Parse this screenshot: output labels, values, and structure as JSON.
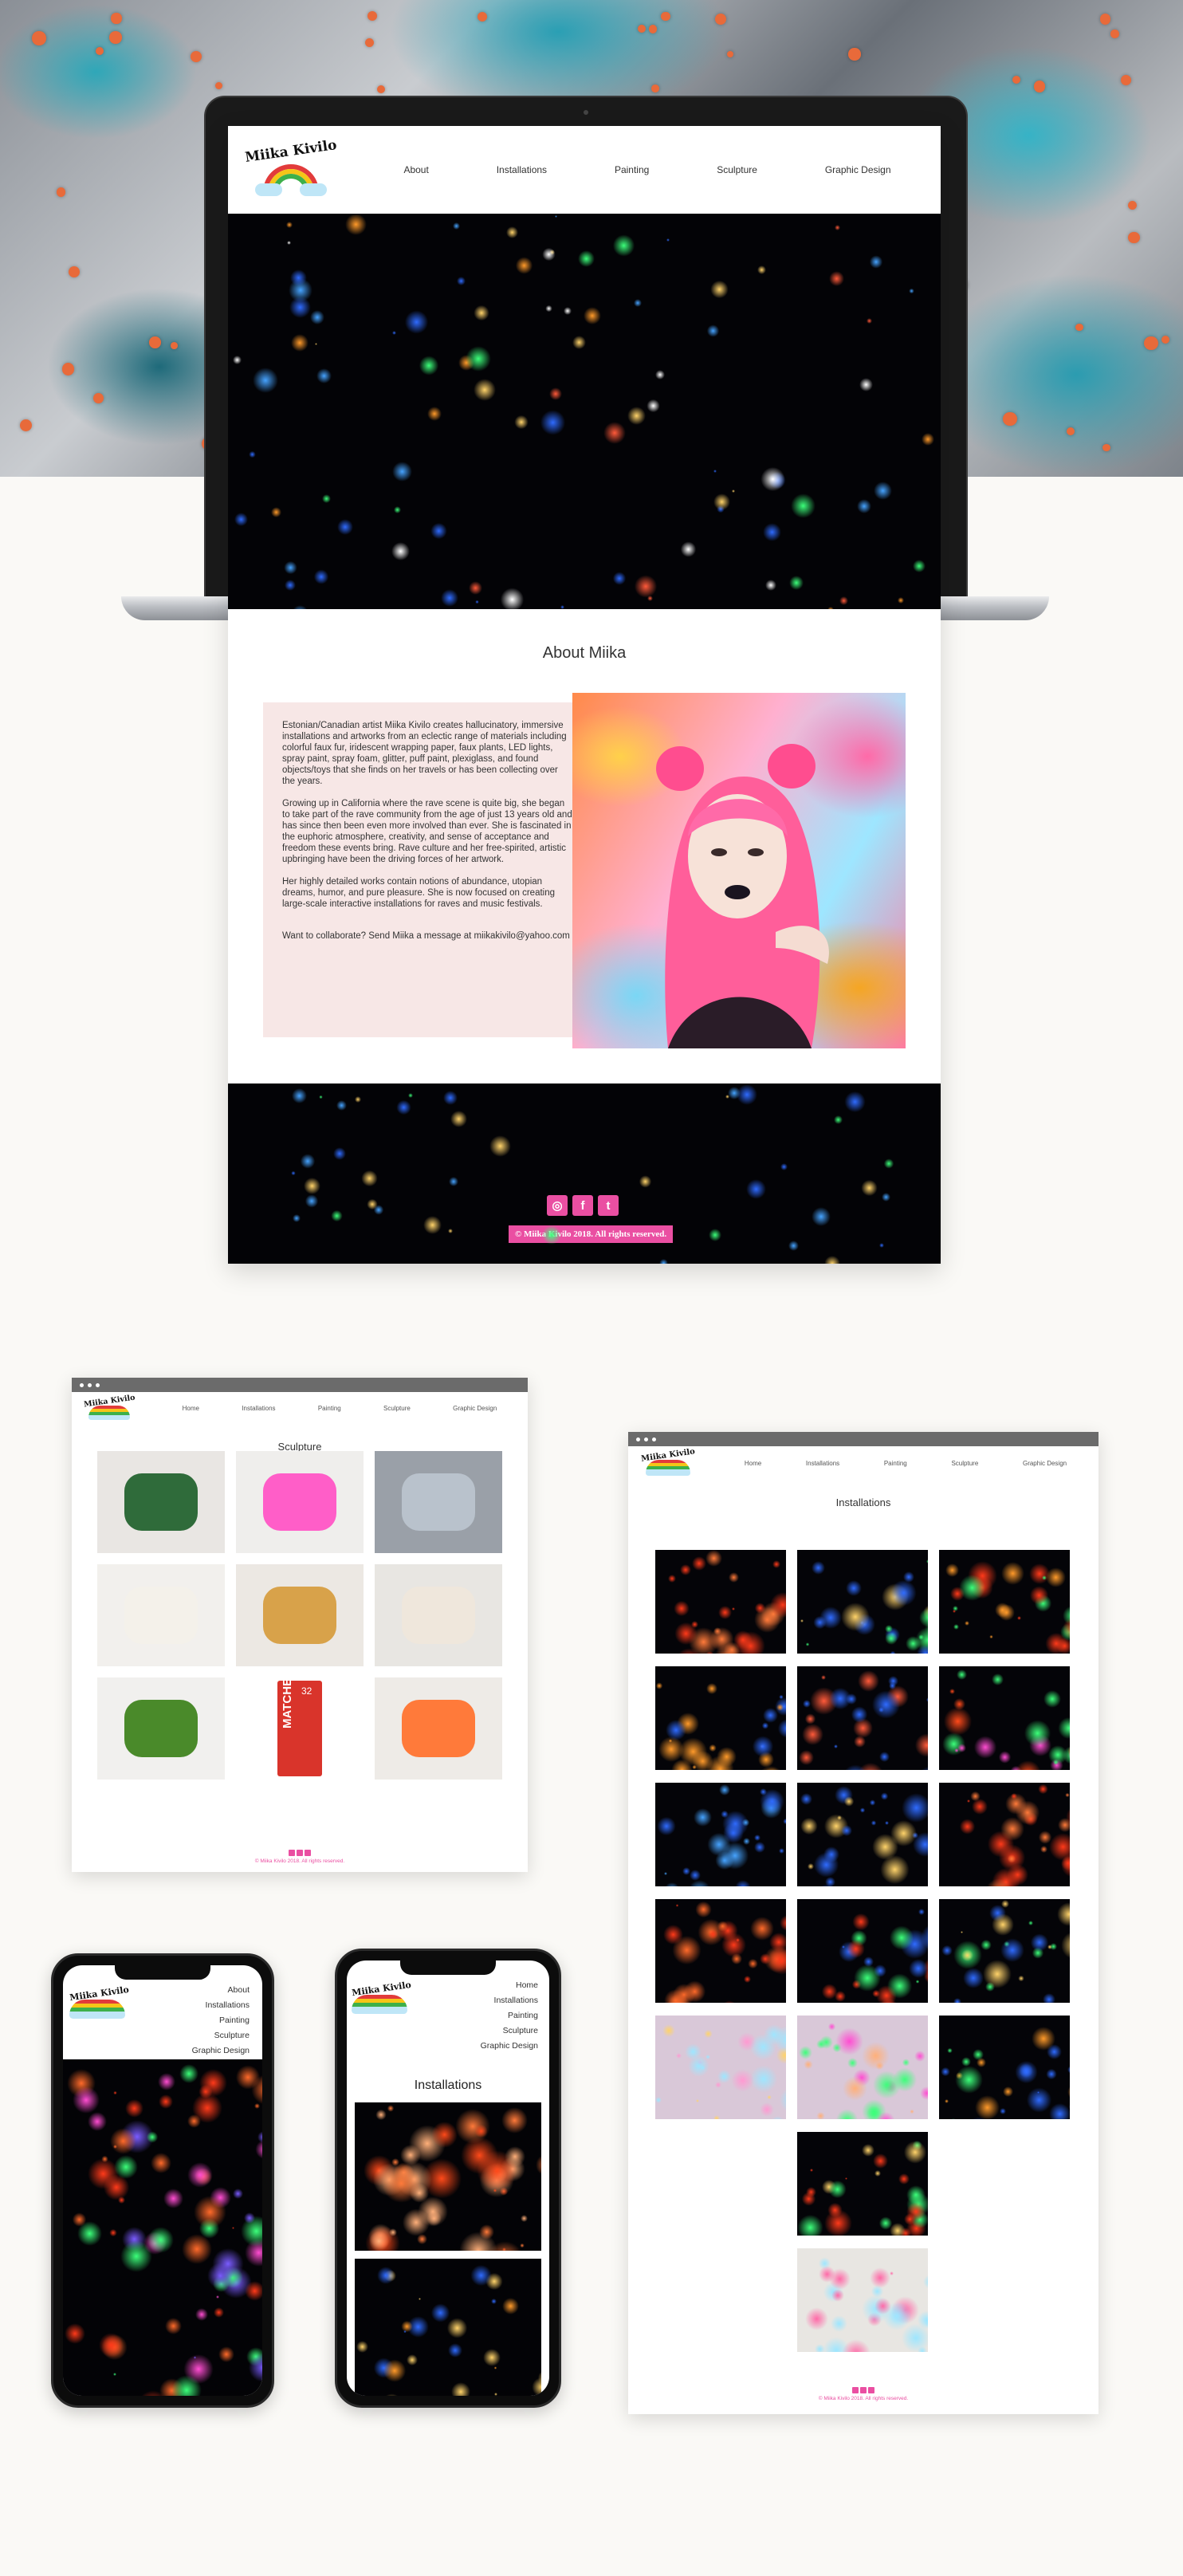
{
  "brand": {
    "logo_text": "Miika Kivilo"
  },
  "nav": {
    "about": "About",
    "installations": "Installations",
    "painting": "Painting",
    "sculpture": "Sculpture",
    "graphic_design": "Graphic Design",
    "home": "Home"
  },
  "about": {
    "title": "About Miika",
    "p1": "Estonian/Canadian artist Miika Kivilo creates hallucinatory, immersive installations and artworks from an eclectic range of materials including colorful faux fur, iridescent wrapping paper, faux plants, LED lights, spray paint, spray foam, glitter, puff paint, plexiglass, and found objects/toys that she finds on her travels or has been collecting over the years.",
    "p2": "Growing up in California where the rave scene is quite big, she began to take part of the rave community from the age of just 13 years old and has since then been even more involved than ever. She is fascinated in the euphoric atmosphere, creativity, and sense of acceptance and freedom these events bring. Rave culture and her free-spirited, artistic upbringing have been the driving forces of her artwork.",
    "p3": "Her highly detailed works contain notions of abundance, utopian dreams, humor, and pure pleasure. She is now focused on creating large-scale interactive installations for raves and music festivals.",
    "p4": "Want to collaborate? Send Miika a message at miikakivilo@yahoo.com"
  },
  "footer": {
    "copyright": "© Miika Kivilo 2018. All rights reserved.",
    "social": {
      "instagram": "◎",
      "facebook": "f",
      "tumblr": "t"
    }
  },
  "sculpture_page": {
    "title": "Sculpture",
    "matches_label": "MATCHES",
    "matches_number": "32"
  },
  "installations_page": {
    "title": "Installations"
  },
  "colors": {
    "accent_pink": "#ea4fa2",
    "about_bg": "#f7e7e6",
    "dark": "#030306"
  }
}
